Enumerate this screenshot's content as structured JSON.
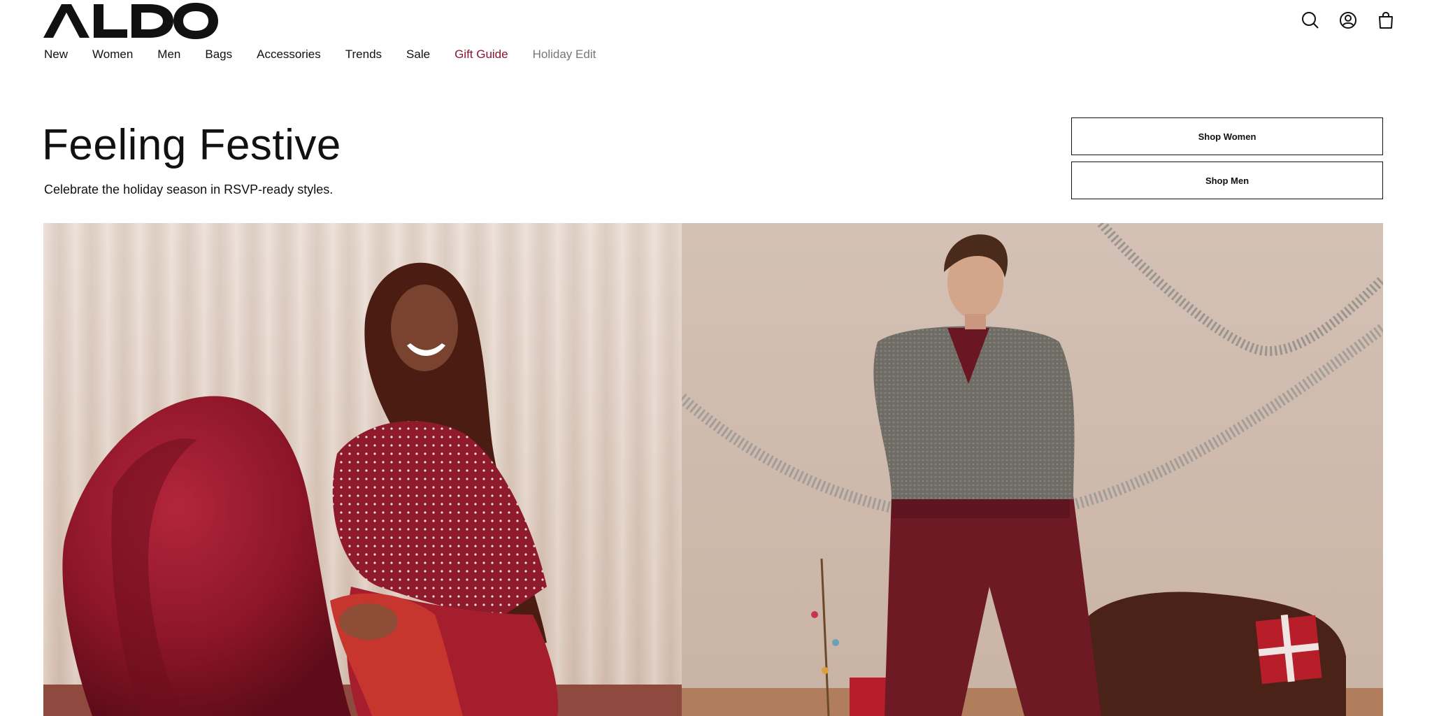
{
  "brand": {
    "name": "ALDO"
  },
  "header_icons": [
    "search-icon",
    "account-icon",
    "shopping-bag-icon"
  ],
  "nav": {
    "items": [
      {
        "label": "New"
      },
      {
        "label": "Women"
      },
      {
        "label": "Men"
      },
      {
        "label": "Bags"
      },
      {
        "label": "Accessories"
      },
      {
        "label": "Trends"
      },
      {
        "label": "Sale"
      },
      {
        "label": "Gift Guide"
      },
      {
        "label": "Holiday Edit"
      }
    ]
  },
  "hero": {
    "title": "Feeling Festive",
    "subtitle": "Celebrate the holiday season in RSVP-ready styles.",
    "cta_women": "Shop Women",
    "cta_men": "Shop Men"
  },
  "colors": {
    "accent": "#8a1430",
    "text": "#111111",
    "muted": "#777777"
  }
}
